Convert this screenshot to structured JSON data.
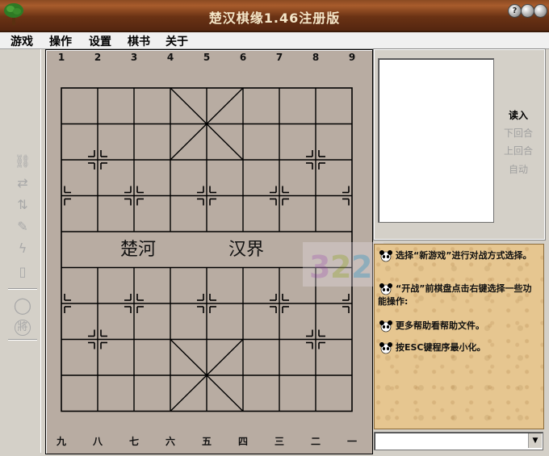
{
  "window": {
    "title": "楚汉棋缘1.46注册版"
  },
  "titlebar_buttons": [
    {
      "name": "help",
      "glyph": "?"
    },
    {
      "name": "minimize",
      "glyph": ""
    },
    {
      "name": "close",
      "glyph": ""
    }
  ],
  "menu": [
    "游戏",
    "操作",
    "设置",
    "棋书",
    "关于"
  ],
  "toolbar": [
    {
      "icon": "link-icon",
      "glyph": "⛓"
    },
    {
      "icon": "swap-horizontal-icon",
      "glyph": "⇄"
    },
    {
      "icon": "swap-vertical-icon",
      "glyph": "⇅"
    },
    {
      "icon": "magic-icon",
      "glyph": "✎"
    },
    {
      "icon": "lightning-icon",
      "glyph": "ϟ"
    },
    {
      "icon": "door-icon",
      "glyph": "▯"
    },
    {
      "icon": "circle-icon",
      "glyph": "◯"
    },
    {
      "icon": "general-piece-icon",
      "glyph": "將"
    }
  ],
  "board": {
    "top_files": [
      "1",
      "2",
      "3",
      "4",
      "5",
      "6",
      "7",
      "8",
      "9"
    ],
    "bottom_files": [
      "九",
      "八",
      "七",
      "六",
      "五",
      "四",
      "三",
      "二",
      "一"
    ],
    "river_left": "楚河",
    "river_right": "汉界"
  },
  "side_buttons": [
    {
      "label": "读入",
      "enabled": true
    },
    {
      "label": "下回合",
      "enabled": false
    },
    {
      "label": "上回合",
      "enabled": false
    },
    {
      "label": "自动",
      "enabled": false
    }
  ],
  "tips": [
    "选择“新游戏”进行对战方式选择。",
    "“开战”前棋盘点击右键选择一些功能操作:",
    "更多帮助看帮助文件。",
    "按ESC键程序最小化。"
  ],
  "combo_value": "",
  "colors": {
    "title_bg": "#6a3214",
    "board_bg": "#b8aca2",
    "info_bg": "#e6c690",
    "disabled_text": "#a0a0a0"
  }
}
